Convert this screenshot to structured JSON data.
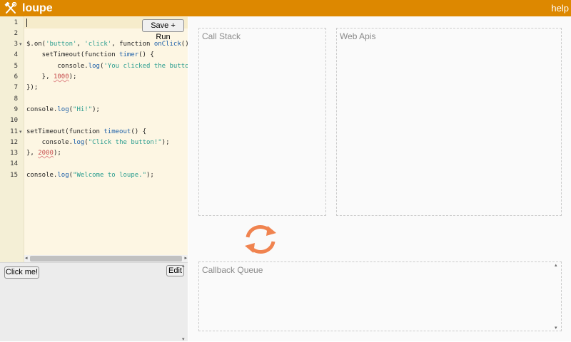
{
  "app": {
    "name": "loupe",
    "help_label": "help"
  },
  "editor": {
    "save_run_label": "Save + Run",
    "line_numbers": [
      "1",
      "2",
      "3",
      "4",
      "5",
      "6",
      "7",
      "8",
      "9",
      "10",
      "11",
      "12",
      "13",
      "14",
      "15"
    ],
    "lines": [
      {
        "n": "1",
        "tokens": []
      },
      {
        "n": "2",
        "tokens": []
      },
      {
        "n": "3",
        "fold": true,
        "tokens": [
          [
            "kw",
            "$.on("
          ],
          [
            "str",
            "'button'"
          ],
          [
            "kw",
            ", "
          ],
          [
            "str",
            "'click'"
          ],
          [
            "kw",
            ", function "
          ],
          [
            "fn",
            "onClick"
          ],
          [
            "kw",
            "() {"
          ]
        ]
      },
      {
        "n": "4",
        "tokens": [
          [
            "kw",
            "    setTimeout(function "
          ],
          [
            "fn",
            "timer"
          ],
          [
            "kw",
            "() {"
          ]
        ]
      },
      {
        "n": "5",
        "tokens": [
          [
            "kw",
            "        console."
          ],
          [
            "fn",
            "log"
          ],
          [
            "kw",
            "("
          ],
          [
            "str",
            "'You clicked the button!'"
          ],
          [
            "kw",
            ");"
          ]
        ]
      },
      {
        "n": "6",
        "tokens": [
          [
            "kw",
            "    }, "
          ],
          [
            "num",
            "1000"
          ],
          [
            "kw",
            ");"
          ]
        ]
      },
      {
        "n": "7",
        "tokens": [
          [
            "kw",
            "});"
          ]
        ]
      },
      {
        "n": "8",
        "tokens": []
      },
      {
        "n": "9",
        "tokens": [
          [
            "kw",
            "console."
          ],
          [
            "fn",
            "log"
          ],
          [
            "kw",
            "("
          ],
          [
            "str",
            "\"Hi!\""
          ],
          [
            "kw",
            ");"
          ]
        ]
      },
      {
        "n": "10",
        "tokens": []
      },
      {
        "n": "11",
        "fold": true,
        "tokens": [
          [
            "kw",
            "setTimeout(function "
          ],
          [
            "fn",
            "timeout"
          ],
          [
            "kw",
            "() {"
          ]
        ]
      },
      {
        "n": "12",
        "tokens": [
          [
            "kw",
            "    console."
          ],
          [
            "fn",
            "log"
          ],
          [
            "kw",
            "("
          ],
          [
            "str",
            "\"Click the button!\""
          ],
          [
            "kw",
            ");"
          ]
        ]
      },
      {
        "n": "13",
        "tokens": [
          [
            "kw",
            "}, "
          ],
          [
            "num",
            "2000"
          ],
          [
            "kw",
            ");"
          ]
        ]
      },
      {
        "n": "14",
        "tokens": []
      },
      {
        "n": "15",
        "tokens": [
          [
            "kw",
            "console."
          ],
          [
            "fn",
            "log"
          ],
          [
            "kw",
            "("
          ],
          [
            "str",
            "\"Welcome to loupe.\""
          ],
          [
            "kw",
            ");"
          ]
        ]
      }
    ]
  },
  "preview": {
    "click_me_label": "Click me!",
    "edit_label": "Edit"
  },
  "panels": {
    "call_stack": "Call Stack",
    "web_apis": "Web Apis",
    "callback_queue": "Callback Queue"
  },
  "colors": {
    "brand": "#dd8800",
    "loop_icon": "#f0834f",
    "editor_bg": "#fdf6e3"
  },
  "icons": {
    "logo": "hammer-wrench-icon",
    "event_loop": "refresh-cycle-icon"
  }
}
